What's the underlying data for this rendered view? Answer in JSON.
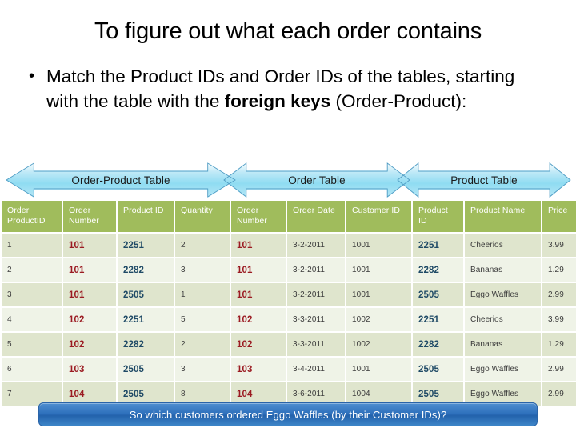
{
  "slide": {
    "title": "To figure out what each order contains",
    "bullet": {
      "marker": "•",
      "part1": "Match the Product IDs and Order IDs of the tables, starting with the table with the ",
      "bold": "foreign keys",
      "part2": " (Order-Product):"
    }
  },
  "banners": [
    {
      "label": "Order-Product Table"
    },
    {
      "label": "Order Table"
    },
    {
      "label": "Product Table"
    }
  ],
  "table": {
    "headers": [
      "Order ProductID",
      "Order Number",
      "Product ID",
      "Quantity",
      "Order Number",
      "Order Date",
      "Customer ID",
      "Product ID",
      "Product Name",
      "Price"
    ],
    "rows": [
      [
        "1",
        "101",
        "2251",
        "2",
        "101",
        "3-2-2011",
        "1001",
        "2251",
        "Cheerios",
        "3.99"
      ],
      [
        "2",
        "101",
        "2282",
        "3",
        "101",
        "3-2-2011",
        "1001",
        "2282",
        "Bananas",
        "1.29"
      ],
      [
        "3",
        "101",
        "2505",
        "1",
        "101",
        "3-2-2011",
        "1001",
        "2505",
        "Eggo Waffles",
        "2.99"
      ],
      [
        "4",
        "102",
        "2251",
        "5",
        "102",
        "3-3-2011",
        "1002",
        "2251",
        "Cheerios",
        "3.99"
      ],
      [
        "5",
        "102",
        "2282",
        "2",
        "102",
        "3-3-2011",
        "1002",
        "2282",
        "Bananas",
        "1.29"
      ],
      [
        "6",
        "103",
        "2505",
        "3",
        "103",
        "3-4-2011",
        "1001",
        "2505",
        "Eggo Waffles",
        "2.99"
      ],
      [
        "7",
        "104",
        "2505",
        "8",
        "104",
        "3-6-2011",
        "1004",
        "2505",
        "Eggo Waffles",
        "2.99"
      ]
    ]
  },
  "cta": {
    "text": "So which customers ordered Eggo Waffles (by their Customer IDs)?"
  },
  "colors": {
    "header_green": "#a0bc5c",
    "row_dark": "#dfe5cd",
    "row_light": "#eff3e7",
    "order_number": "#9b1b22",
    "product_id": "#1f4a66",
    "banner_blue": "#2f71bd",
    "arrow_blue": "#8fdcf2"
  }
}
